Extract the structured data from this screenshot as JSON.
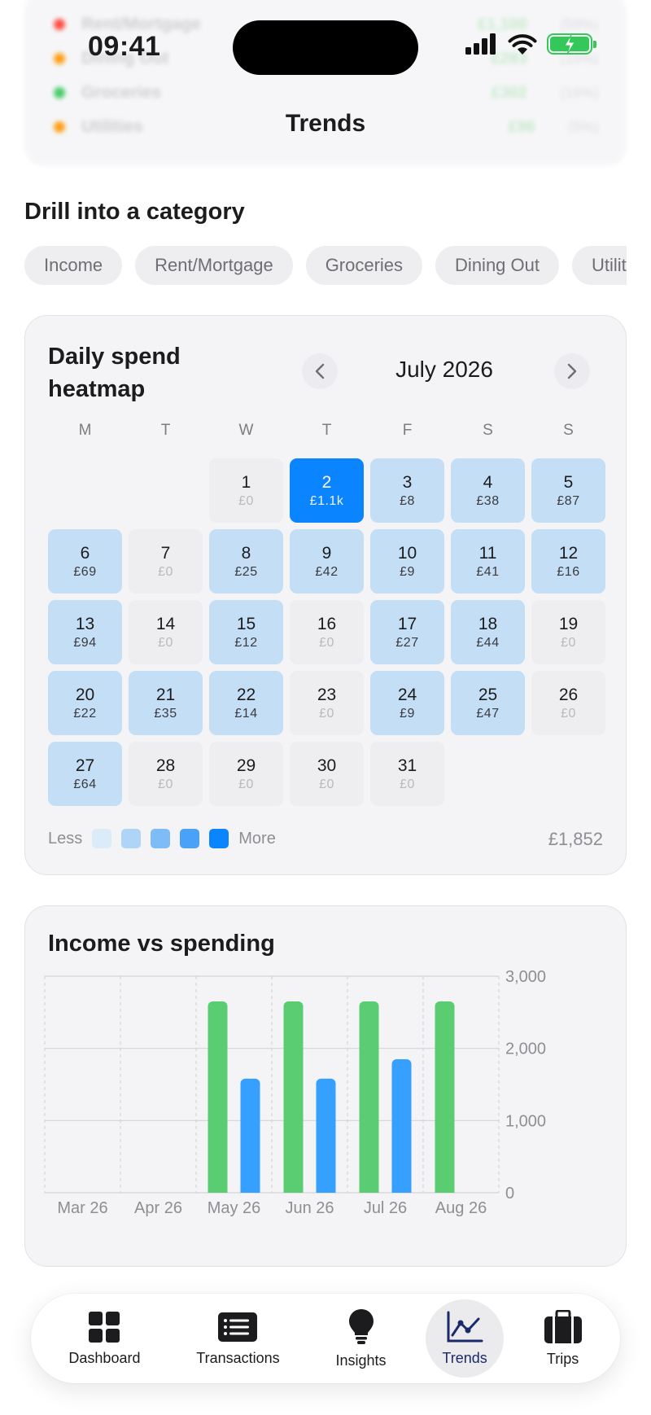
{
  "status": {
    "time": "09:41"
  },
  "ghost": {
    "rows": [
      {
        "name": "Rent/Mortgage",
        "amount": "£1,100",
        "pct": "(59%)",
        "color": "#ff3b30"
      },
      {
        "name": "Dining Out",
        "amount": "£283",
        "pct": "(15%)",
        "color": "#ff9500"
      },
      {
        "name": "Groceries",
        "amount": "£302",
        "pct": "(16%)",
        "color": "#34c759"
      },
      {
        "name": "Utilities",
        "amount": "£96",
        "pct": "(5%)",
        "color": "#ff9500"
      }
    ]
  },
  "page": {
    "title": "Trends"
  },
  "drill": {
    "title": "Drill into a category",
    "chips": [
      "Income",
      "Rent/Mortgage",
      "Groceries",
      "Dining Out",
      "Utilities"
    ]
  },
  "heatmap": {
    "title": "Daily spend heatmap",
    "month": "July 2026",
    "weekdays": [
      "M",
      "T",
      "W",
      "T",
      "F",
      "S",
      "S"
    ],
    "leading_blanks": 2,
    "days": [
      {
        "d": "1",
        "v": "£0",
        "level": "zero"
      },
      {
        "d": "2",
        "v": "£1.1k",
        "level": "max"
      },
      {
        "d": "3",
        "v": "£8",
        "level": "low"
      },
      {
        "d": "4",
        "v": "£38",
        "level": "low"
      },
      {
        "d": "5",
        "v": "£87",
        "level": "low"
      },
      {
        "d": "6",
        "v": "£69",
        "level": "low"
      },
      {
        "d": "7",
        "v": "£0",
        "level": "zero"
      },
      {
        "d": "8",
        "v": "£25",
        "level": "low"
      },
      {
        "d": "9",
        "v": "£42",
        "level": "low"
      },
      {
        "d": "10",
        "v": "£9",
        "level": "low"
      },
      {
        "d": "11",
        "v": "£41",
        "level": "low"
      },
      {
        "d": "12",
        "v": "£16",
        "level": "low"
      },
      {
        "d": "13",
        "v": "£94",
        "level": "low"
      },
      {
        "d": "14",
        "v": "£0",
        "level": "zero"
      },
      {
        "d": "15",
        "v": "£12",
        "level": "low"
      },
      {
        "d": "16",
        "v": "£0",
        "level": "zero"
      },
      {
        "d": "17",
        "v": "£27",
        "level": "low"
      },
      {
        "d": "18",
        "v": "£44",
        "level": "low"
      },
      {
        "d": "19",
        "v": "£0",
        "level": "zero"
      },
      {
        "d": "20",
        "v": "£22",
        "level": "low"
      },
      {
        "d": "21",
        "v": "£35",
        "level": "low"
      },
      {
        "d": "22",
        "v": "£14",
        "level": "low"
      },
      {
        "d": "23",
        "v": "£0",
        "level": "zero"
      },
      {
        "d": "24",
        "v": "£9",
        "level": "low"
      },
      {
        "d": "25",
        "v": "£47",
        "level": "low"
      },
      {
        "d": "26",
        "v": "£0",
        "level": "zero"
      },
      {
        "d": "27",
        "v": "£64",
        "level": "low"
      },
      {
        "d": "28",
        "v": "£0",
        "level": "zero"
      },
      {
        "d": "29",
        "v": "£0",
        "level": "zero"
      },
      {
        "d": "30",
        "v": "£0",
        "level": "zero"
      },
      {
        "d": "31",
        "v": "£0",
        "level": "zero"
      }
    ],
    "legend": {
      "less": "Less",
      "more": "More",
      "colors": [
        "#dcebf8",
        "#aed4f7",
        "#7ebcf7",
        "#4aa2f8",
        "#0a84ff"
      ]
    },
    "total": "£1,852"
  },
  "chart_data": {
    "type": "bar",
    "title": "Income vs spending",
    "categories": [
      "Mar 26",
      "Apr 26",
      "May 26",
      "Jun 26",
      "Jul 26",
      "Aug 26"
    ],
    "series": [
      {
        "values": [
          0,
          0,
          2650,
          2650,
          2650,
          2650
        ],
        "color": "#5acd72"
      },
      {
        "values": [
          0,
          0,
          1580,
          1580,
          1850,
          0
        ],
        "color": "#35a0ff"
      }
    ],
    "ylim": [
      0,
      3000
    ],
    "yticks": [
      "0",
      "1,000",
      "2,000",
      "3,000"
    ],
    "grid": true
  },
  "tabbar": {
    "tabs": [
      {
        "label": "Dashboard",
        "icon": "dashboard-grid-icon"
      },
      {
        "label": "Transactions",
        "icon": "transactions-list-icon"
      },
      {
        "label": "Insights",
        "icon": "lightbulb-icon"
      },
      {
        "label": "Trends",
        "icon": "trend-line-icon",
        "active": true
      },
      {
        "label": "Trips",
        "icon": "suitcase-icon"
      }
    ]
  }
}
